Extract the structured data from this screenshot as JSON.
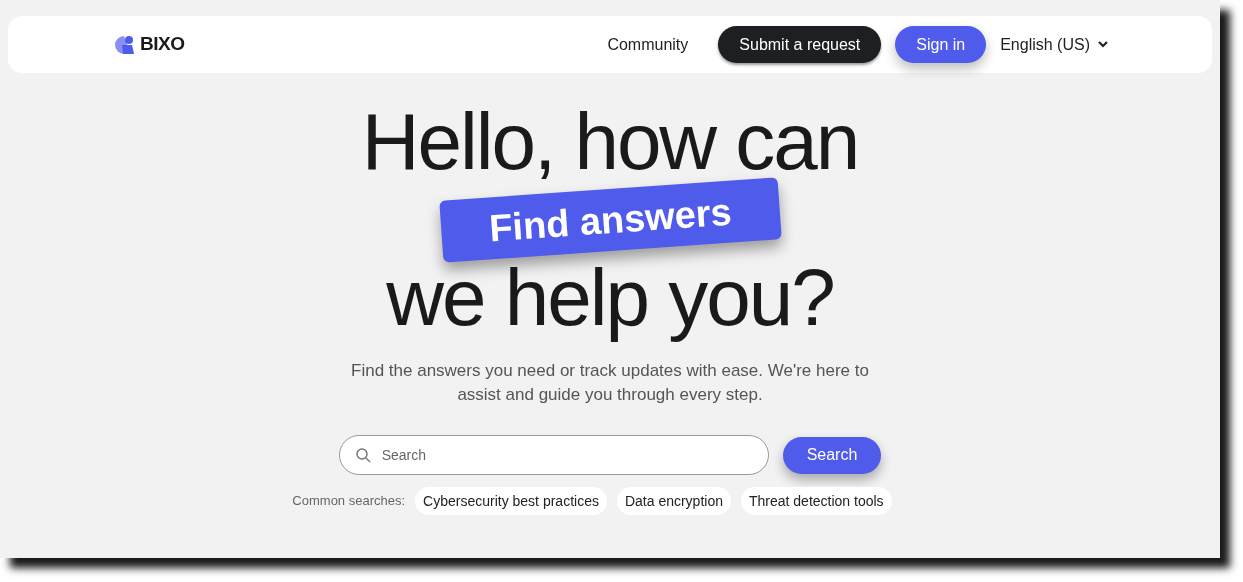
{
  "header": {
    "logo": "BIXO",
    "nav": [
      {
        "label": "Community",
        "kind": "link"
      },
      {
        "label": "Submit a request",
        "kind": "dark"
      },
      {
        "label": "Sign in",
        "kind": "primary"
      }
    ],
    "language": "English (US)"
  },
  "hero": {
    "title_lines": [
      "Hello, how can",
      "we help you?"
    ],
    "badge": "Find answers",
    "subtitle": "Find the answers you need or track updates with ease. We're here to assist and guide you through every step."
  },
  "search": {
    "placeholder": "Search",
    "button": "Search"
  },
  "common_searches": {
    "label": "Common searches:",
    "items": [
      "Cybersecurity best practices",
      "Data encryption",
      "Threat detection tools"
    ]
  }
}
